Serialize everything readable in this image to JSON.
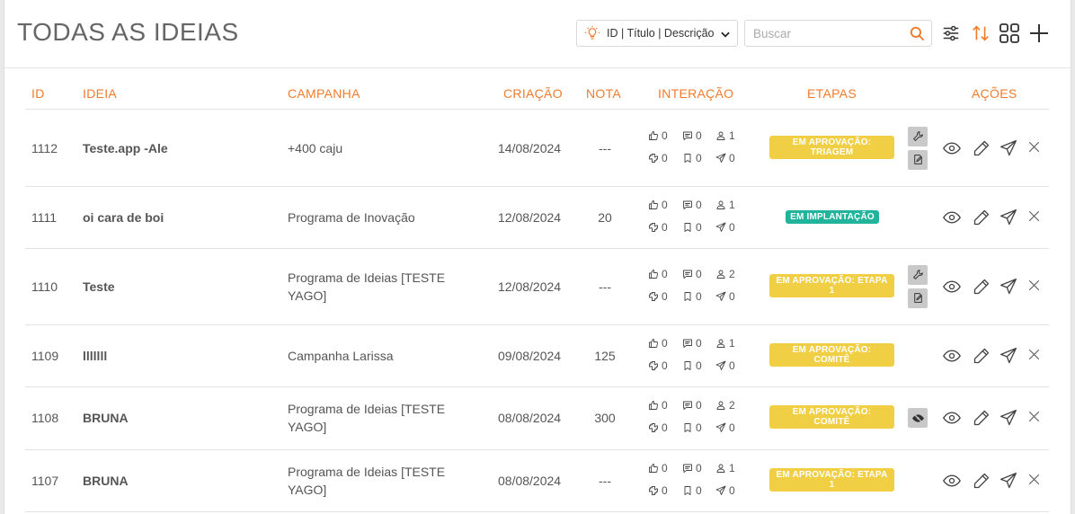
{
  "header": {
    "title": "TODAS AS IDEIAS",
    "filter_label": "ID | Título | Descrição",
    "search_placeholder": "Buscar"
  },
  "colors": {
    "accent": "#f07b2c",
    "badge_yellow": "#f0cf45",
    "badge_green": "#21b39b",
    "text": "#555555"
  },
  "columns": [
    "ID",
    "IDEIA",
    "CAMPANHA",
    "CRIAÇÃO",
    "NOTA",
    "INTERAÇÃO",
    "ETAPAS",
    "AÇÕES"
  ],
  "rows": [
    {
      "id": "1112",
      "ideia": "Teste.app -Ale",
      "campanha": [
        "+400 caju"
      ],
      "criacao": "14/08/2024",
      "nota": "---",
      "likes": "0",
      "comments": "0",
      "users": "1",
      "puzzle": "0",
      "bookmarks": "0",
      "sends": "0",
      "etapa": [
        "EM APROVAÇÃO:",
        "TRIAGEM"
      ],
      "etapa_color": "yellow",
      "extra_icons": [
        "wrench-icon",
        "edit-document-icon"
      ]
    },
    {
      "id": "1111",
      "ideia": "oi cara de boi",
      "campanha": [
        "Programa de Inovação"
      ],
      "criacao": "12/08/2024",
      "nota": "20",
      "likes": "0",
      "comments": "0",
      "users": "1",
      "puzzle": "0",
      "bookmarks": "0",
      "sends": "0",
      "etapa": [
        "EM IMPLANTAÇÃO"
      ],
      "etapa_color": "green",
      "extra_icons": []
    },
    {
      "id": "1110",
      "ideia": "Teste",
      "campanha": [
        "Programa de Ideias [TESTE",
        "YAGO]"
      ],
      "criacao": "12/08/2024",
      "nota": "---",
      "likes": "0",
      "comments": "0",
      "users": "2",
      "puzzle": "0",
      "bookmarks": "0",
      "sends": "0",
      "etapa": [
        "EM APROVAÇÃO: ETAPA",
        "1"
      ],
      "etapa_color": "yellow",
      "extra_icons": [
        "wrench-icon",
        "edit-document-icon"
      ]
    },
    {
      "id": "1109",
      "ideia": "lllllll",
      "campanha": [
        "Campanha Larissa"
      ],
      "criacao": "09/08/2024",
      "nota": "125",
      "likes": "0",
      "comments": "0",
      "users": "1",
      "puzzle": "0",
      "bookmarks": "0",
      "sends": "0",
      "etapa": [
        "EM APROVAÇÃO:",
        "COMITÊ"
      ],
      "etapa_color": "yellow",
      "extra_icons": []
    },
    {
      "id": "1108",
      "ideia": "BRUNA",
      "campanha": [
        "Programa de Ideias [TESTE",
        "YAGO]"
      ],
      "criacao": "08/08/2024",
      "nota": "300",
      "likes": "0",
      "comments": "0",
      "users": "2",
      "puzzle": "0",
      "bookmarks": "0",
      "sends": "0",
      "etapa": [
        "EM APROVAÇÃO:",
        "COMITÊ"
      ],
      "etapa_color": "yellow",
      "extra_icons": [
        "eye-off-icon"
      ]
    },
    {
      "id": "1107",
      "ideia": "BRUNA",
      "campanha": [
        "Programa de Ideias [TESTE",
        "YAGO]"
      ],
      "criacao": "08/08/2024",
      "nota": "---",
      "likes": "0",
      "comments": "0",
      "users": "1",
      "puzzle": "0",
      "bookmarks": "0",
      "sends": "0",
      "etapa": [
        "EM APROVAÇÃO: ETAPA",
        "1"
      ],
      "etapa_color": "yellow",
      "extra_icons": []
    }
  ]
}
